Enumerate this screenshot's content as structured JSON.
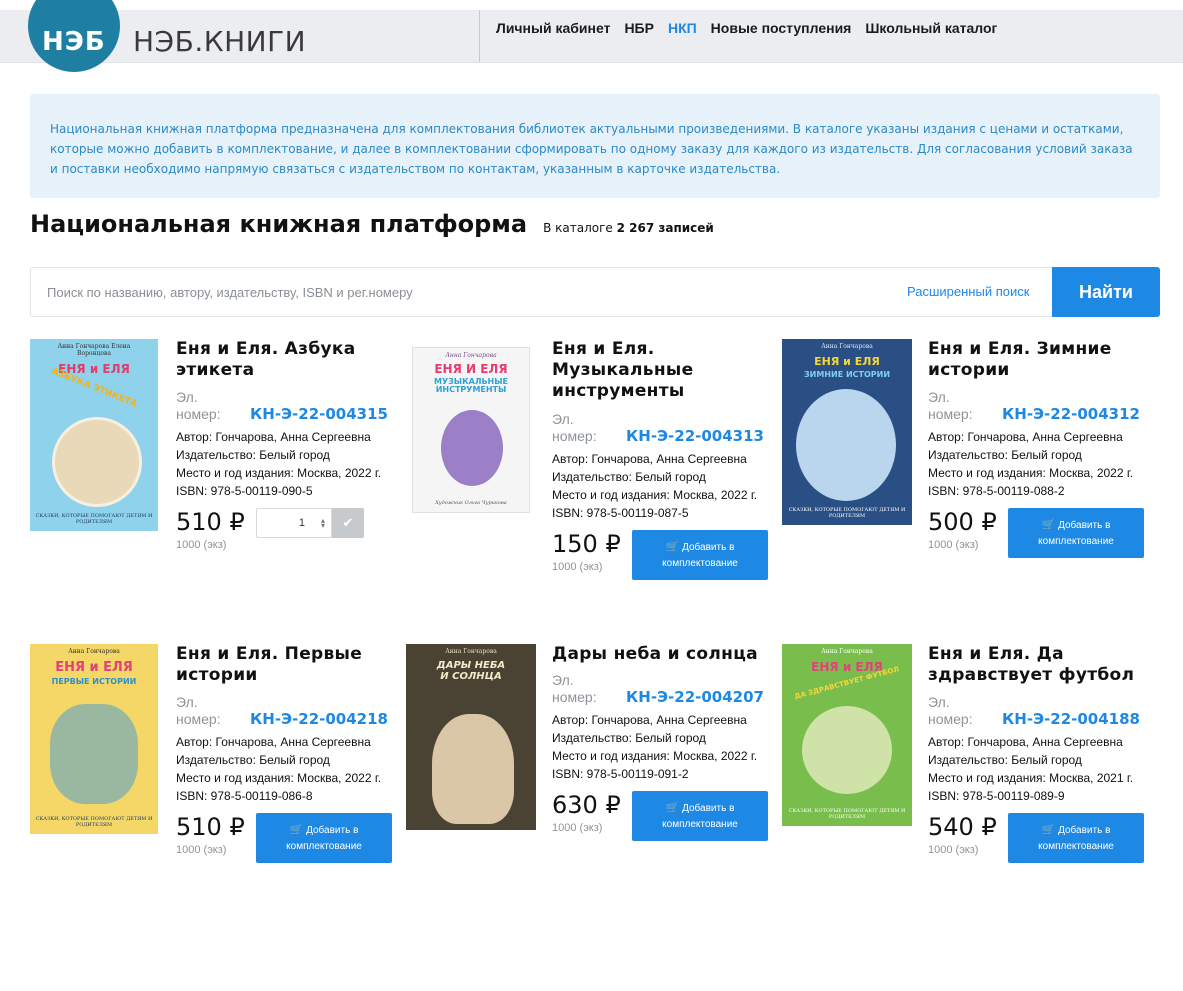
{
  "header": {
    "logo_abbr": "НЭБ",
    "logo_name": "НЭБ.КНИГИ",
    "nav": [
      "Личный кабинет",
      "НБР",
      "НКП",
      "Новые поступления",
      "Школьный каталог"
    ]
  },
  "info_text": "Национальная книжная платформа предназначена для комплектования библиотек актуальными произведениями. В каталоге указаны издания с ценами и остатками, которые можно добавить в комплектование, и далее в комплектовании сформировать по одному заказу для каждого из издательств. Для согласования условий заказа и поставки необходимо напрямую связаться с издательством по контактам, указанным в карточке издательства.",
  "page": {
    "title": "Национальная книжная платформа",
    "count_prefix": "В каталоге",
    "count_value": "2 267 записей"
  },
  "search": {
    "placeholder": "Поиск по названию, автору, издательству, ISBN и рег.номеру",
    "advanced_label": "Расширенный поиск",
    "find_label": "Найти"
  },
  "labels": {
    "reg_label": "Эл. номер:",
    "add_line1": "Добавить в",
    "add_line2": "комплектование"
  },
  "books": [
    {
      "title": "Еня и Еля. Азбука этикета",
      "reg": "КН-Э-22-004315",
      "author": "Автор: Гончарова, Анна Сергеевна",
      "publisher": "Издательство: Белый город",
      "place": "Место и год издания: Москва, 2022 г.",
      "isbn": "ISBN:  978-5-00119-090-5",
      "price": "510 ₽",
      "stock": "1000 (экз)",
      "qty": "1",
      "cover_author": "Анна Гончарова Елена Воронцова",
      "cover_title": "ЕНЯ и ЕЛЯ",
      "cover_subtitle": "АЗБУКА ЭТИКЕТА",
      "cover_series": "СКАЗКИ, КОТОРЫЕ ПОМОГАЮТ ДЕТЯМ И РОДИТЕЛЯМ"
    },
    {
      "title": "Еня и Еля. Музыкальные инструменты",
      "reg": "КН-Э-22-004313",
      "author": "Автор: Гончарова, Анна Сергеевна",
      "publisher": "Издательство: Белый город",
      "place": "Место и год издания: Москва, 2022 г.",
      "isbn": "ISBN:  978-5-00119-087-5",
      "price": "150 ₽",
      "stock": "1000 (экз)",
      "cover_author": "Анна Гончарова",
      "cover_title": "ЕНЯ И ЕЛЯ",
      "cover_subtitle": "МУЗЫКАЛЬНЫЕ ИНСТРУМЕНТЫ",
      "cover_series": "Художник Ольга Чурикова"
    },
    {
      "title": "Еня и Еля. Зимние истории",
      "reg": "КН-Э-22-004312",
      "author": "Автор: Гончарова, Анна Сергеевна",
      "publisher": "Издательство: Белый город",
      "place": "Место и год издания: Москва, 2022 г.",
      "isbn": "ISBN:  978-5-00119-088-2",
      "price": "500 ₽",
      "stock": "1000 (экз)",
      "cover_author": "Анна Гончарова",
      "cover_title": "ЕНЯ и ЕЛЯ",
      "cover_subtitle": "ЗИМНИЕ ИСТОРИИ",
      "cover_series": "СКАЗКИ, КОТОРЫЕ ПОМОГАЮТ ДЕТЯМ И РОДИТЕЛЯМ"
    },
    {
      "title": "Еня и Еля. Первые истории",
      "reg": "КН-Э-22-004218",
      "author": "Автор: Гончарова, Анна Сергеевна",
      "publisher": "Издательство: Белый город",
      "place": "Место и год издания: Москва, 2022 г.",
      "isbn": "ISBN:  978-5-00119-086-8",
      "price": "510 ₽",
      "stock": "1000 (экз)",
      "cover_author": "Анна Гончарова",
      "cover_title": "ЕНЯ и ЕЛЯ",
      "cover_subtitle": "ПЕРВЫЕ ИСТОРИИ",
      "cover_series": "СКАЗКИ, КОТОРЫЕ ПОМОГАЮТ ДЕТЯМ И РОДИТЕЛЯМ"
    },
    {
      "title": "Дары неба и солнца",
      "reg": "КН-Э-22-004207",
      "author": "Автор: Гончарова, Анна Сергеевна",
      "publisher": "Издательство: Белый город",
      "place": "Место и год издания: Москва, 2022 г.",
      "isbn": "ISBN:  978-5-00119-091-2",
      "price": "630 ₽",
      "stock": "1000 (экз)",
      "cover_author": "Анна Гончарова",
      "cover_title": "ДАРЫ НЕБА И СОЛНЦА",
      "cover_subtitle": "",
      "cover_series": ""
    },
    {
      "title": "Еня и Еля. Да здравствует футбол",
      "reg": "КН-Э-22-004188",
      "author": "Автор: Гончарова, Анна Сергеевна",
      "publisher": "Издательство: Белый город",
      "place": "Место и год издания: Москва, 2021 г.",
      "isbn": "ISBN:  978-5-00119-089-9",
      "price": "540 ₽",
      "stock": "1000 (экз)",
      "cover_author": "Анна Гончарова",
      "cover_title": "ЕНЯ и ЕЛЯ",
      "cover_subtitle": "ДА ЗДРАВСТВУЕТ ФУТБОЛ",
      "cover_series": "СКАЗКИ, КОТОРЫЕ ПОМОГАЮТ ДЕТЯМ И РОДИТЕЛЯМ"
    }
  ],
  "colors": {
    "accent": "#1e88e5",
    "logo": "#1f7fa3",
    "info_bg": "#e6f1fa",
    "info_text": "#2b8ac8",
    "header_bg": "#ecedf1"
  }
}
